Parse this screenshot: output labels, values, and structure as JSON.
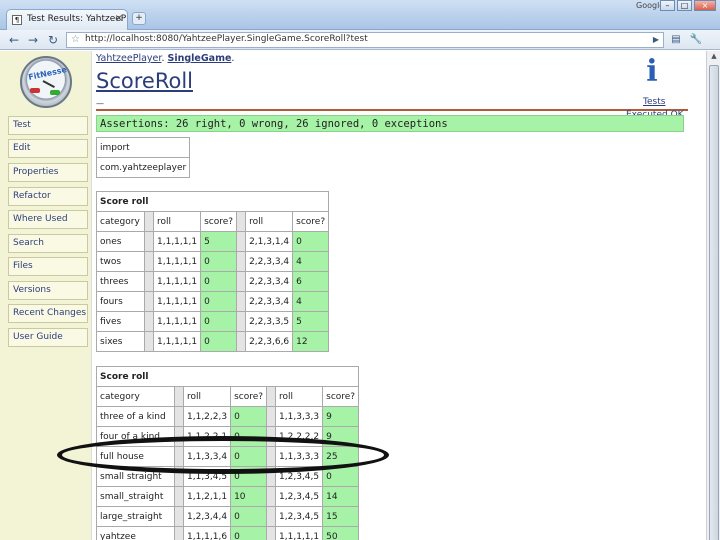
{
  "browser": {
    "tab_title": "Test Results: YahtzeePlay...",
    "tab_close": "×",
    "new_tab": "+",
    "brand": "Google",
    "minimize": "–",
    "maximize": "□",
    "close": "×",
    "url": "http://localhost:8080/YahtzeePlayer.SingleGame.ScoreRoll?test",
    "back": "←",
    "forward": "→",
    "reload": "↻",
    "go": "▶",
    "page_menu": "▤",
    "tools_menu": "🔧"
  },
  "sidebar": {
    "logo_text": "FitNesse",
    "items": [
      "Test",
      "Edit",
      "Properties",
      "Refactor",
      "Where Used",
      "Search",
      "Files",
      "Versions",
      "Recent Changes",
      "User Guide"
    ]
  },
  "page": {
    "breadcrumb_parent": "YahtzeePlayer",
    "breadcrumb_current": "SingleGame",
    "breadcrumb_sep": ".",
    "breadcrumb_end": ".",
    "title": "ScoreRoll",
    "dash": "—",
    "info_glyph": "i",
    "tests_link": "Tests",
    "executed_link": "Executed OK",
    "assertions": "Assertions: 26 right, 0 wrong, 26 ignored, 0 exceptions"
  },
  "import_table": {
    "title": "import",
    "value": "com.yahtzeeplayer"
  },
  "table1": {
    "title": "Score roll",
    "headers": [
      "category",
      "roll",
      "score?",
      "roll",
      "score?"
    ],
    "rows": [
      [
        "ones",
        "1,1,1,1,1",
        "5",
        "2,1,3,1,4",
        "0"
      ],
      [
        "twos",
        "1,1,1,1,1",
        "0",
        "2,2,3,3,4",
        "4"
      ],
      [
        "threes",
        "1,1,1,1,1",
        "0",
        "2,2,3,3,4",
        "6"
      ],
      [
        "fours",
        "1,1,1,1,1",
        "0",
        "2,2,3,3,4",
        "4"
      ],
      [
        "fives",
        "1,1,1,1,1",
        "0",
        "2,2,3,3,5",
        "5"
      ],
      [
        "sixes",
        "1,1,1,1,1",
        "0",
        "2,2,3,6,6",
        "12"
      ]
    ]
  },
  "table2": {
    "title": "Score roll",
    "headers": [
      "category",
      "roll",
      "score?",
      "roll",
      "score?"
    ],
    "rows": [
      [
        "three of a kind",
        "1,1,2,2,3",
        "0",
        "1,1,3,3,3",
        "9"
      ],
      [
        "four of a kind",
        "1,1,2,2,1",
        "0",
        "1,2,2,2,2",
        "9"
      ],
      [
        "full house",
        "1,1,3,3,4",
        "0",
        "1,1,3,3,3",
        "25"
      ],
      [
        "small straight",
        "1,1,3,4,5",
        "0",
        "1,2,3,4,5",
        "0"
      ],
      [
        "small_straight",
        "1,1,2,1,1",
        "10",
        "1,2,3,4,5",
        "14"
      ],
      [
        "large_straight",
        "1,2,3,4,4",
        "0",
        "1,2,3,4,5",
        "15"
      ],
      [
        "yahtzee",
        "1,1,1,1,6",
        "0",
        "1,1,1,1,1",
        "50"
      ]
    ]
  }
}
